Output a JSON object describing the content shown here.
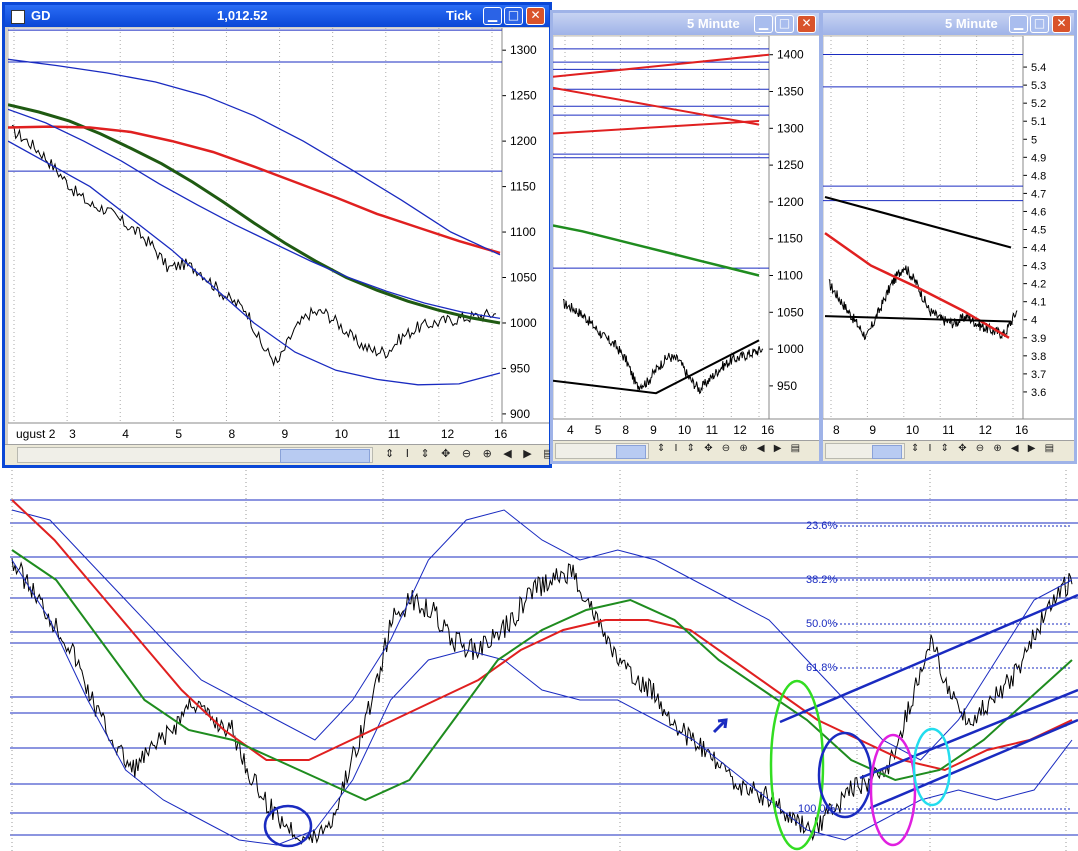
{
  "windows": {
    "w1": {
      "title": "GD",
      "price": "1,012.52",
      "label": "Tick"
    },
    "w2": {
      "title": "5 Minute"
    },
    "w3": {
      "title": "5 Minute"
    }
  },
  "controls": {
    "minimize": "▁",
    "maximize": "□",
    "close": "✕",
    "nav": "⇕ I ⇕ ✥ ⊖ ⊕ ◀ ▶ ▤"
  },
  "chart_data": [
    {
      "type": "line",
      "title": "GD",
      "y_ticks": [
        1300,
        1250,
        1200,
        1150,
        1100,
        1050,
        1000,
        950,
        900
      ],
      "x_ticks": [
        "ugust 2",
        "3",
        "4",
        "5",
        "8",
        "9",
        "10",
        "11",
        "12",
        "16"
      ],
      "ylim": [
        890,
        1320
      ],
      "series": [
        {
          "role": "price",
          "values": [
            1212,
            1200,
            1185,
            1165,
            1145,
            1130,
            1125,
            1112,
            1100,
            1085,
            1060,
            1065,
            1058,
            1040,
            1025,
            1015,
            975,
            955,
            990,
            1010,
            1012,
            998,
            980,
            970,
            968,
            985,
            995,
            1000,
            1003,
            1006,
            1008,
            1010
          ]
        },
        {
          "role": "ma-green",
          "color": "#1f5a12",
          "values": [
            1240,
            1232,
            1222,
            1208,
            1192,
            1175,
            1155,
            1133,
            1110,
            1088,
            1068,
            1050,
            1036,
            1024,
            1014,
            1006,
            1000
          ]
        },
        {
          "role": "ma-red",
          "color": "#e02020",
          "values": [
            1215,
            1216,
            1215,
            1210,
            1200,
            1188,
            1172,
            1155,
            1138,
            1120,
            1105,
            1090,
            1077
          ]
        },
        {
          "role": "band-upper",
          "color": "#1a2bc0",
          "values": [
            1290,
            1283,
            1275,
            1265,
            1250,
            1228,
            1200,
            1168,
            1135,
            1100,
            1075
          ]
        },
        {
          "role": "band-mid",
          "color": "#1a2bc0",
          "values": [
            1235,
            1220,
            1200,
            1178,
            1153,
            1130,
            1108,
            1088,
            1068,
            1050,
            1035,
            1022,
            1012,
            1005
          ]
        },
        {
          "role": "band-lower",
          "color": "#1a2bc0",
          "values": [
            1200,
            1175,
            1150,
            1115,
            1080,
            1040,
            1000,
            968,
            948,
            938,
            932,
            933,
            945
          ]
        }
      ],
      "hlines": [
        1322,
        1287,
        1167
      ]
    },
    {
      "type": "line",
      "title": "5 Minute",
      "y_ticks": [
        1400,
        1350,
        1300,
        1250,
        1200,
        1150,
        1100,
        1050,
        1000,
        950
      ],
      "x_ticks": [
        "4",
        "5",
        "8",
        "9",
        "10",
        "11",
        "12",
        "16"
      ],
      "ylim": [
        905,
        1420
      ],
      "series": [
        {
          "role": "price",
          "values": [
            1062,
            1055,
            1045,
            1030,
            1015,
            1005,
            985,
            950,
            955,
            975,
            990,
            985,
            960,
            945,
            960,
            975,
            985,
            990,
            995,
            1000
          ]
        },
        {
          "role": "trend-black",
          "color": "#000000",
          "values": [
            957,
            940,
            1012
          ]
        },
        {
          "role": "trend-green",
          "color": "#1f8c1f",
          "values": [
            1168,
            1160,
            1150,
            1140,
            1130,
            1120,
            1110,
            1100
          ]
        },
        {
          "role": "trend-red",
          "color": "#e02020",
          "values": [
            1370,
            1400
          ]
        },
        {
          "role": "trend-red-2",
          "color": "#e02020",
          "values": [
            1355,
            1330,
            1305
          ]
        },
        {
          "role": "trend-red-3",
          "color": "#e02020",
          "values": [
            1293,
            1310
          ]
        }
      ],
      "hlines": [
        1408,
        1390,
        1380,
        1330,
        1353,
        1318,
        1265,
        1260,
        1110
      ]
    },
    {
      "type": "line",
      "title": "5 Minute",
      "y_ticks": [
        5.4,
        5.3,
        5.2,
        5.1,
        5.0,
        4.9,
        4.8,
        4.7,
        4.6,
        4.5,
        4.4,
        4.3,
        4.2,
        4.1,
        4.0,
        3.9,
        3.8,
        3.7,
        3.6
      ],
      "x_ticks": [
        "8",
        "9",
        "10",
        "11",
        "12",
        "16"
      ],
      "ylim": [
        3.45,
        5.55
      ],
      "series": [
        {
          "role": "price",
          "values": [
            4.2,
            4.1,
            4.0,
            3.9,
            4.05,
            4.2,
            4.3,
            4.2,
            4.05,
            4.0,
            3.98,
            4.02,
            3.97,
            3.94,
            3.92,
            4.05
          ]
        },
        {
          "role": "trend-red",
          "color": "#e02020",
          "values": [
            4.48,
            4.3,
            4.18,
            4.05,
            3.9
          ]
        },
        {
          "role": "trend-black",
          "color": "#000000",
          "values": [
            4.68,
            4.4
          ]
        },
        {
          "role": "trend-black-2",
          "color": "#000000",
          "values": [
            4.02,
            3.99
          ]
        }
      ],
      "hlines": [
        5.47,
        5.29,
        4.74,
        4.66
      ]
    },
    {
      "type": "line",
      "title": "",
      "fib_levels": [
        "23.6%",
        "38.2%",
        "50.0%",
        "61.8%",
        "100.0%"
      ],
      "series": [
        {
          "role": "price",
          "values": [
            560,
            590,
            620,
            650,
            700,
            740,
            770,
            750,
            730,
            700,
            720,
            730,
            780,
            810,
            830,
            840,
            820,
            760,
            700,
            620,
            600,
            610,
            640,
            650,
            640,
            620,
            590,
            580,
            570,
            610,
            650,
            680,
            690,
            720,
            740,
            760,
            780,
            790,
            800,
            820,
            830,
            810,
            790,
            780,
            760,
            700,
            640,
            700,
            720,
            700,
            680,
            640,
            600,
            580
          ]
        },
        {
          "role": "ma-red",
          "color": "#e02020",
          "values": [
            500,
            540,
            590,
            640,
            690,
            730,
            760,
            760,
            740,
            720,
            700,
            680,
            650,
            630,
            620,
            620,
            630,
            660,
            690,
            720,
            740,
            760,
            770,
            750,
            740,
            720
          ]
        },
        {
          "role": "ma-green",
          "color": "#1f8c1f",
          "values": [
            550,
            580,
            640,
            700,
            730,
            740,
            760,
            780,
            800,
            780,
            720,
            660,
            630,
            610,
            600,
            620,
            660,
            690,
            720,
            760,
            780,
            770,
            740,
            700,
            660
          ]
        }
      ]
    }
  ]
}
